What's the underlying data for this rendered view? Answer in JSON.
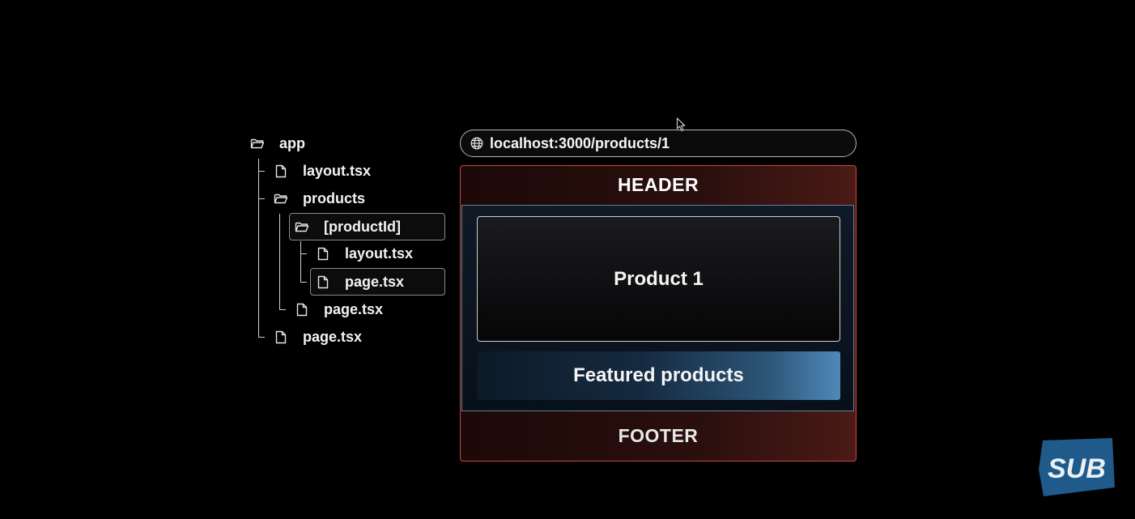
{
  "tree": {
    "app": "app",
    "app_layout": "layout.tsx",
    "products": "products",
    "product_id": "[productId]",
    "product_id_layout": "layout.tsx",
    "product_id_page": "page.tsx",
    "products_page": "page.tsx",
    "app_page": "page.tsx"
  },
  "browser": {
    "url": "localhost:3000/products/1",
    "header": "HEADER",
    "product_title": "Product 1",
    "featured": "Featured products",
    "footer": "FOOTER"
  },
  "logo": {
    "text": "SUB",
    "color": "#1f5a8a"
  },
  "colors": {
    "layout_border": "#c9473c",
    "nested_border": "#5f7f9c",
    "featured_accent": "#4f89b8"
  }
}
